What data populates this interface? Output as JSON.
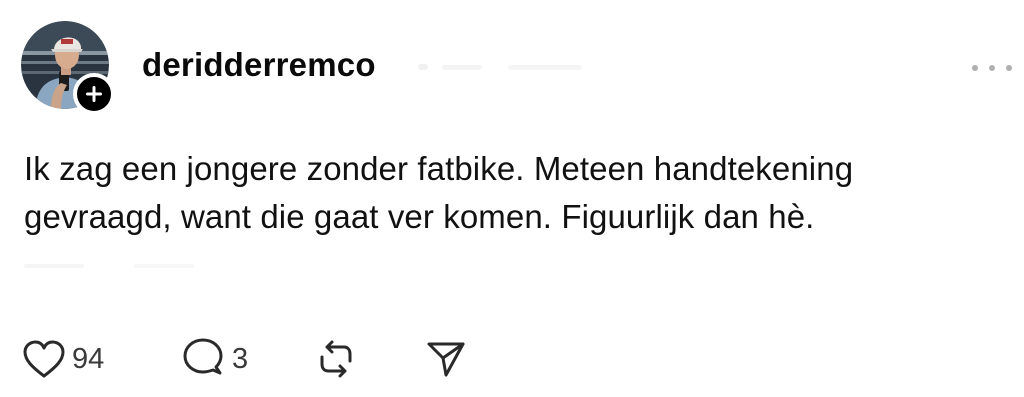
{
  "post": {
    "username": "deridderremco",
    "text_line1": "Ik zag een jongere zonder fatbike. Meteen handtekening",
    "text_line2": "gevraagd, want die gaat ver komen. Figuurlijk dan hè."
  },
  "actions": {
    "like_count": "94",
    "reply_count": "3"
  },
  "icons": {
    "follow": "plus-icon",
    "more": "more-horizontal-icon",
    "like": "heart-icon",
    "reply": "speech-bubble-icon",
    "repost": "repost-icon",
    "share": "send-icon"
  }
}
